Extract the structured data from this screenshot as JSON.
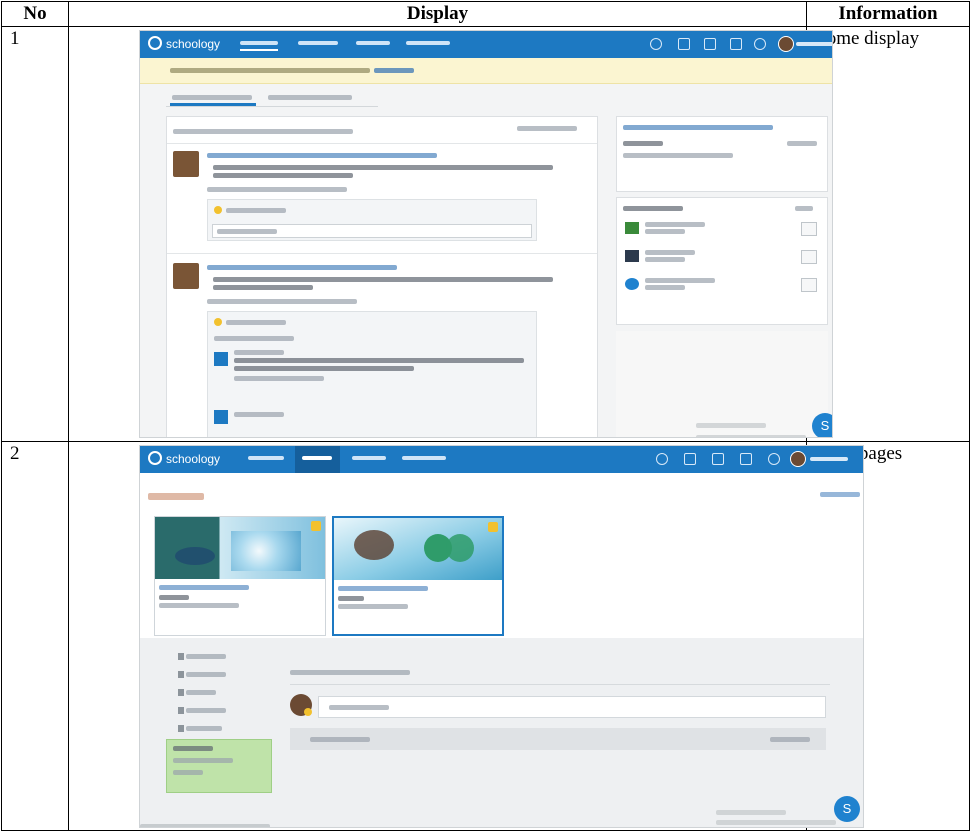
{
  "table": {
    "headers": {
      "no": "No",
      "display": "Display",
      "information": "Information"
    },
    "rows": [
      {
        "no": "1",
        "information": "Home display"
      },
      {
        "no": "2",
        "information": "Class pages"
      }
    ]
  },
  "screenshots": {
    "brand": "schoology",
    "fab_label": "S",
    "colors": {
      "nav": "#1d79c2",
      "notice": "#fbf5d1",
      "green_panel": "#bfe3a9"
    }
  }
}
